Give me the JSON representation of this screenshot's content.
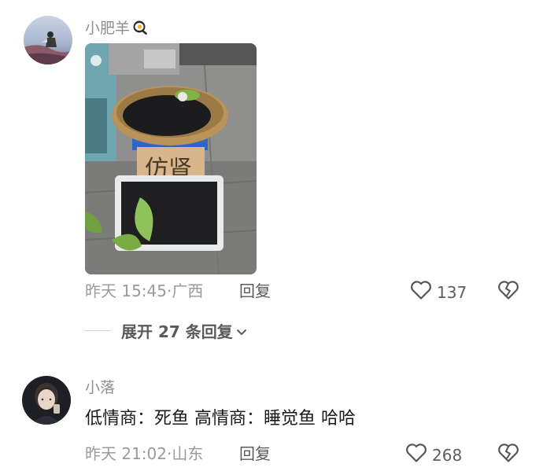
{
  "comments": [
    {
      "username": "小肥羊",
      "username_emoji_icon": "frying-egg-icon",
      "date": "昨天 15:45",
      "location": "广西",
      "separator": "·",
      "reply_label": "回复",
      "like_count": "137",
      "image_sign_text": "仿肾"
    },
    {
      "username": "小落",
      "text": "低情商：死鱼 高情商：睡觉鱼 哈哈",
      "date": "昨天 21:02",
      "location": "山东",
      "separator": "·",
      "reply_label": "回复",
      "like_count": "268"
    }
  ],
  "expand_replies": {
    "label": "展开 27 条回复",
    "icon": "chevron-down-icon"
  },
  "colors": {
    "meta_gray": "#9a9a9a",
    "username_gray": "#8f8f8f",
    "text_dark": "#1a1a1a"
  }
}
